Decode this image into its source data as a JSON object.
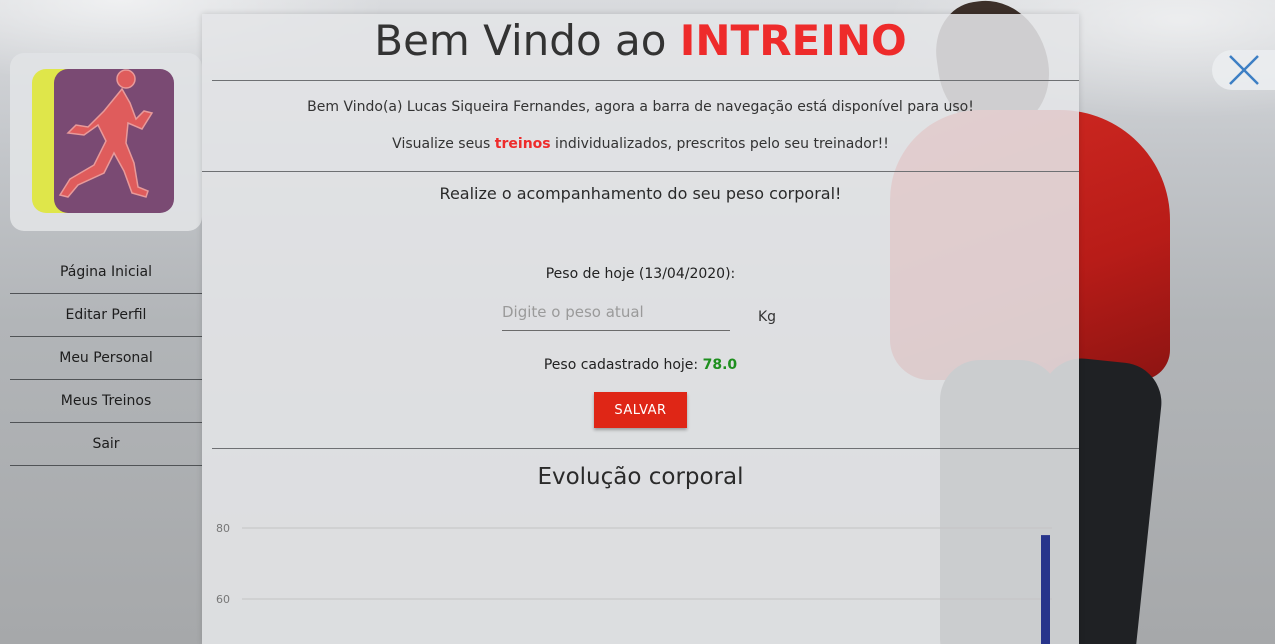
{
  "app": {
    "title_prefix": "Bem Vindo ao ",
    "title_brand": "INTREINO",
    "brand_color": "#ee2b2b"
  },
  "sidebar": {
    "logo": "runner-logo",
    "items": [
      {
        "label": "Página Inicial",
        "name": "sidebar-item-pagina-inicial"
      },
      {
        "label": "Editar Perfil",
        "name": "sidebar-item-editar-perfil"
      },
      {
        "label": "Meu Personal",
        "name": "sidebar-item-meu-personal"
      },
      {
        "label": "Meus Treinos",
        "name": "sidebar-item-meus-treinos"
      },
      {
        "label": "Sair",
        "name": "sidebar-item-sair"
      }
    ]
  },
  "close": {
    "icon": "close-icon"
  },
  "main": {
    "welcome_text": "Bem Vindo(a) Lucas Siqueira Fernandes, agora a barra de navegação está disponível para uso!",
    "visualize_before": "Visualize seus ",
    "visualize_highlight": "treinos",
    "visualize_after": " individualizados, prescritos pelo seu treinador!!",
    "track_text": "Realize o acompanhamento do seu peso corporal!",
    "peso_label": "Peso de hoje (13/04/2020):",
    "peso_placeholder": "Digite o peso atual",
    "peso_value": "",
    "unit": "Kg",
    "peso_cadastrado_label": "Peso cadastrado hoje: ",
    "peso_cadastrado_value": "78.0",
    "save_label": "SALVAR",
    "save_color": "#df2616"
  },
  "chart_data": {
    "type": "bar",
    "title": "Evolução corporal",
    "yticks": [
      80,
      60
    ],
    "series": [
      {
        "values": [
          78.0
        ],
        "color": "#27348b"
      }
    ],
    "grid": true
  }
}
